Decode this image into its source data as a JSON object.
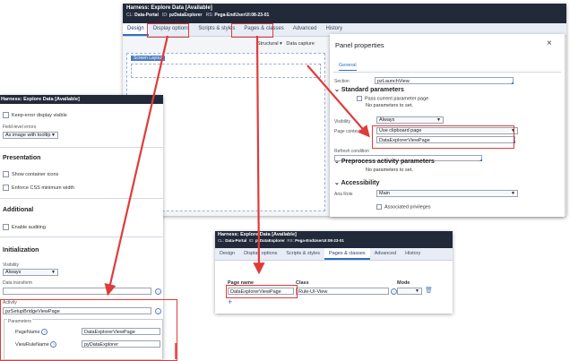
{
  "main_window": {
    "title": "Harness: Explore Data [Available]",
    "cl_label": "CL:",
    "cl_value": "Data-Portal",
    "id_label": "ID:",
    "id_value": "pzDataExplorer",
    "rs_label": "RS:",
    "rs_value": "Pega-EndUserUI:08-23-01",
    "tabs": [
      "Design",
      "Display options",
      "Scripts & styles",
      "Pages & classes",
      "Advanced",
      "History"
    ],
    "toolbar": {
      "structural": "Structural",
      "data_capture": "Data capture",
      "screen_layout": "Screen Layout"
    }
  },
  "panel_properties": {
    "title": "Panel properties",
    "tab": "General",
    "section_label": "Section",
    "section_value": "pzLaunchView",
    "standard_params_header": "Standard parameters",
    "pass_current": "Pass current parameter page",
    "no_params_1": "No parameters to set.",
    "visibility_label": "Visibility",
    "visibility_value": "Always",
    "page_context_label": "Page context",
    "page_context_value": "Use clipboard page",
    "page_context_page": "DataExplorerViewPage",
    "refresh_label": "Refresh condition",
    "preprocess_header": "Preprocess activity parameters",
    "no_params_2": "No parameters to set.",
    "accessibility_header": "Accessibility",
    "aria_label": "Aria Role",
    "aria_value": "Main",
    "associated": "Associated privileges"
  },
  "display_options": {
    "title": "Harness: Explore Data [Available]",
    "keep_error": "Keep-error display visible",
    "field_errors_label": "Field-level errors",
    "field_errors_value": "As image with tooltip",
    "presentation_header": "Presentation",
    "show_container": "Show container icons",
    "enforce_css": "Enforce CSS minimum width",
    "additional_header": "Additional",
    "enable_auditing": "Enable auditing",
    "initialization_header": "Initialization",
    "visibility_label": "Visibility",
    "visibility_value": "Always",
    "data_transform_label": "Data transform",
    "activity_label": "Activity",
    "activity_value": "pzSetupBridgeViewPage",
    "parameters_label": "Parameters",
    "param1_name": "PageName",
    "param1_value": "DataExplorerViewPage",
    "param2_name": "ViewRuleName",
    "param2_value": "pyDataExplorer"
  },
  "pages_classes": {
    "title": "Harness: Explore Data [Available]",
    "cl_label": "CL:",
    "cl_value": "Data-Portal",
    "id_label": "ID:",
    "id_value": "pzDataExplorer",
    "rs_label": "RS:",
    "rs_value": "Pega-EndUserUI:08-23-01",
    "tabs": [
      "Design",
      "Display options",
      "Scripts & styles",
      "Pages & classes",
      "Advanced",
      "History"
    ],
    "col_page_name": "Page name",
    "col_class": "Class",
    "col_mode": "Mode",
    "row_page_name": "DataExplorerViewPage",
    "row_class": "Rule-UI-View",
    "add_symbol": "+"
  },
  "colors": {
    "annotation_red": "#e03b3b",
    "header_dark": "#222a3a",
    "accent_blue": "#2f6fbf"
  }
}
